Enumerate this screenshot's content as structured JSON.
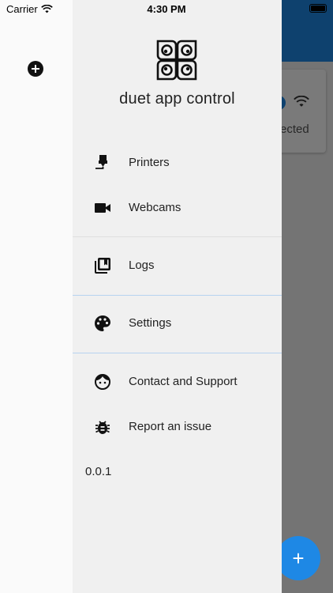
{
  "status_bar": {
    "carrier": "Carrier",
    "time": "4:30 PM"
  },
  "background": {
    "card_status": "ected"
  },
  "drawer": {
    "app_name": "duet app control",
    "items": [
      {
        "label": "Printers",
        "icon": "printer-icon"
      },
      {
        "label": "Webcams",
        "icon": "videocam-icon"
      },
      {
        "label": "Logs",
        "icon": "library-books-icon"
      },
      {
        "label": "Settings",
        "icon": "palette-icon"
      },
      {
        "label": "Contact and Support",
        "icon": "face-icon"
      },
      {
        "label": "Report an issue",
        "icon": "bug-icon"
      }
    ],
    "version": "0.0.1"
  },
  "colors": {
    "accent": "#1e88e5",
    "drawer_bg": "#f0f0f0",
    "divider": "#b7d3f0"
  }
}
